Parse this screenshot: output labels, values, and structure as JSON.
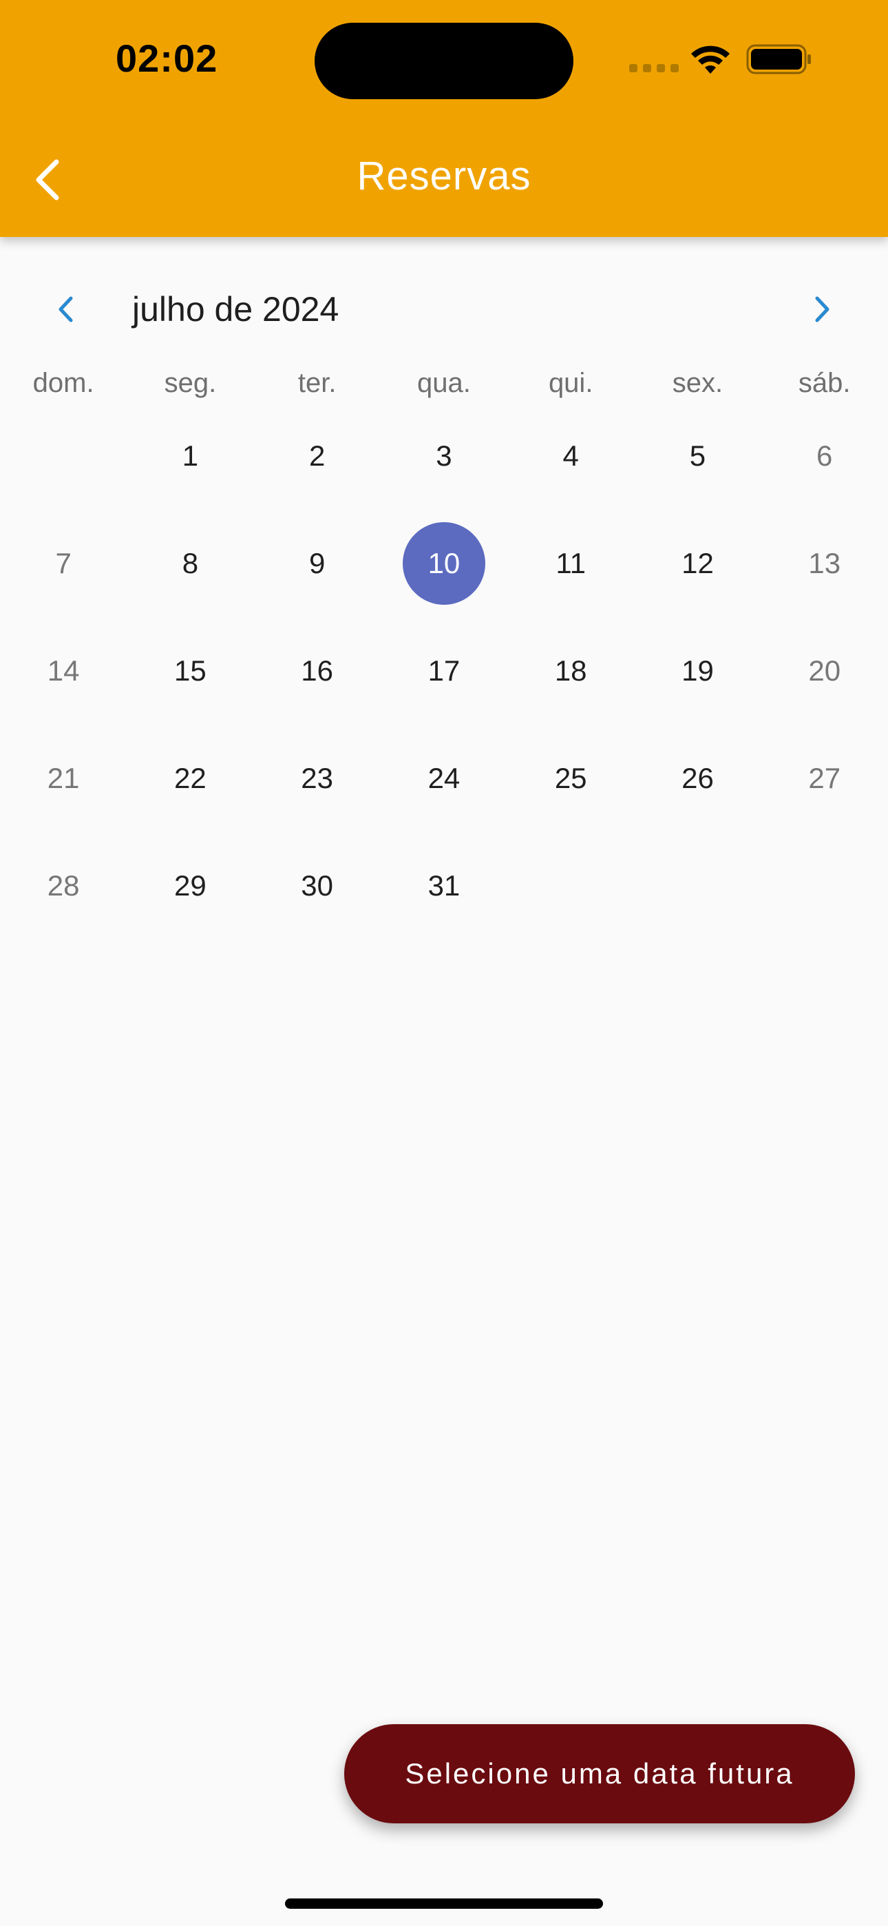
{
  "status_bar": {
    "time": "02:02"
  },
  "header": {
    "title": "Reservas",
    "back_icon": "chevron-left-icon",
    "background": "#f0a300"
  },
  "calendar": {
    "month_label": "julho de 2024",
    "weekdays": [
      "dom.",
      "seg.",
      "ter.",
      "qua.",
      "qui.",
      "sex.",
      "sáb."
    ],
    "selected_day": "10",
    "selected_color": "#5c6bc0",
    "nav_color": "#2a8ad0",
    "weeks": [
      [
        "",
        "1",
        "2",
        "3",
        "4",
        "5",
        "6"
      ],
      [
        "7",
        "8",
        "9",
        "10",
        "11",
        "12",
        "13"
      ],
      [
        "14",
        "15",
        "16",
        "17",
        "18",
        "19",
        "20"
      ],
      [
        "21",
        "22",
        "23",
        "24",
        "25",
        "26",
        "27"
      ],
      [
        "28",
        "29",
        "30",
        "31",
        "",
        "",
        ""
      ]
    ]
  },
  "toast": {
    "message": "Selecione uma data futura",
    "background": "#6a0b0f"
  }
}
